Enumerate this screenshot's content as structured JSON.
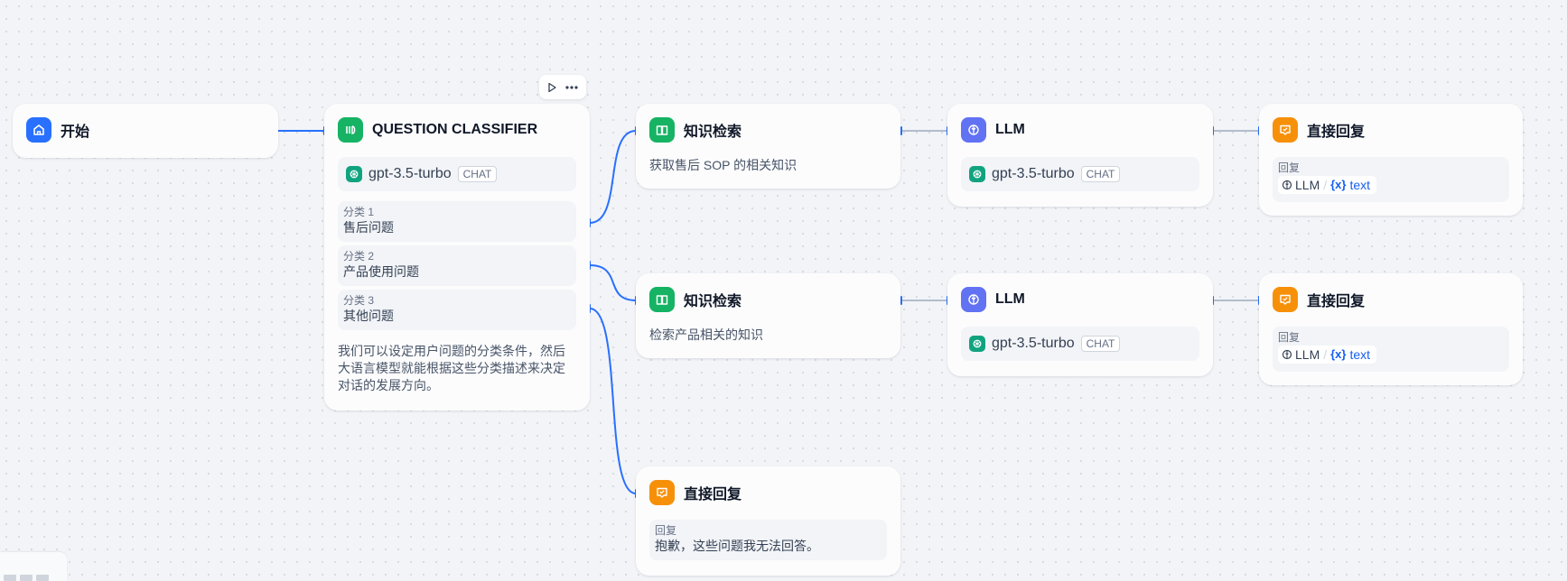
{
  "colors": {
    "start": "#2970ff",
    "classifier": "#16b364",
    "knowledge": "#16b364",
    "llm": "#6172f3",
    "answer": "#f79009",
    "edge_active": "#2970ff",
    "edge_idle": "#b2bccc"
  },
  "toolbar": {
    "run_icon": "play-icon",
    "more_icon": "more-icon"
  },
  "nodes": {
    "start": {
      "title": "开始",
      "icon": "home-icon"
    },
    "classifier": {
      "title": "QUESTION CLASSIFIER",
      "icon": "classifier-icon",
      "model": "gpt-3.5-turbo",
      "mode": "CHAT",
      "classes": [
        {
          "label": "分类 1",
          "value": "售后问题"
        },
        {
          "label": "分类 2",
          "value": "产品使用问题"
        },
        {
          "label": "分类 3",
          "value": "其他问题"
        }
      ],
      "desc": "我们可以设定用户问题的分类条件，然后大语言模型就能根据这些分类描述来决定对话的发展方向。"
    },
    "knowledge1": {
      "title": "知识检索",
      "icon": "book-icon",
      "desc": "获取售后 SOP 的相关知识"
    },
    "knowledge2": {
      "title": "知识检索",
      "icon": "book-icon",
      "desc": "检索产品相关的知识"
    },
    "llm1": {
      "title": "LLM",
      "icon": "llm-icon",
      "model": "gpt-3.5-turbo",
      "mode": "CHAT"
    },
    "llm2": {
      "title": "LLM",
      "icon": "llm-icon",
      "model": "gpt-3.5-turbo",
      "mode": "CHAT"
    },
    "answer1": {
      "title": "直接回复",
      "icon": "answer-icon",
      "label": "回复",
      "var_node": "LLM",
      "var_name": "text"
    },
    "answer2": {
      "title": "直接回复",
      "icon": "answer-icon",
      "label": "回复",
      "var_node": "LLM",
      "var_name": "text"
    },
    "answer3": {
      "title": "直接回复",
      "icon": "answer-icon",
      "label": "回复",
      "text": "抱歉，这些问题我无法回答。"
    }
  },
  "var_slash": "/",
  "var_x": "{x}"
}
